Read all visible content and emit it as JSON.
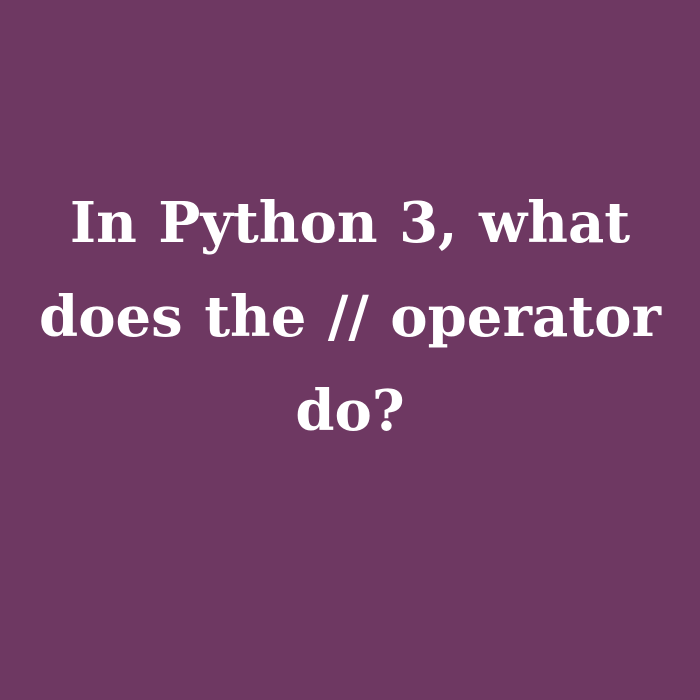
{
  "card": {
    "question": "In Python 3, what does the // operator do?",
    "background_color": "#6e3862",
    "text_color": "#ffffff"
  }
}
